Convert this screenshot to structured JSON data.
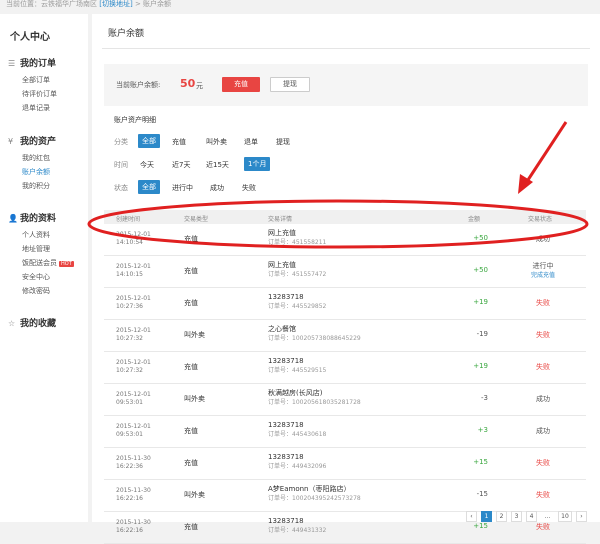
{
  "breadcrumb": {
    "prefix": "当前位置：",
    "location": "云铁福华广场南区",
    "switch_link": "[切换地址]",
    "current": "> 账户余额"
  },
  "sidebar": {
    "user_center": "个人中心",
    "sections": [
      {
        "icon": "☰",
        "title": "我的订单",
        "items": [
          "全部订单",
          "待评价订单",
          "退单记录"
        ]
      },
      {
        "icon": "¥",
        "title": "我的资产",
        "items": [
          "我的红包",
          "账户余额",
          "我的积分"
        ]
      },
      {
        "icon": "👤",
        "title": "我的资料",
        "items": [
          "个人资料",
          "地址管理",
          "饭配送会员",
          "安全中心",
          "修改密码"
        ],
        "hot_badge": "HOT"
      },
      {
        "icon": "☆",
        "title": "我的收藏",
        "items": []
      }
    ],
    "active_item": "账户余额"
  },
  "main": {
    "title": "账户余额",
    "balance_label": "当前账户余额:",
    "balance_amount": "50",
    "balance_unit": "元",
    "recharge_button": "充值",
    "withdraw_button": "提现",
    "detail_title": "账户资产明细",
    "filters": [
      {
        "key": "分类",
        "options": [
          "全部",
          "充值",
          "叫外卖",
          "退单",
          "提现"
        ],
        "selected": "全部"
      },
      {
        "key": "时间",
        "options": [
          "今天",
          "近7天",
          "近15天",
          "1个月"
        ],
        "selected": "1个月"
      },
      {
        "key": "状态",
        "options": [
          "全部",
          "进行中",
          "成功",
          "失败"
        ],
        "selected": "全部"
      }
    ]
  },
  "table": {
    "headers": [
      "创建时间",
      "交易类型",
      "交易详情",
      "金额",
      "交易状态"
    ],
    "rows": [
      {
        "date": "2015-12-01",
        "time": "14:10:54",
        "type": "充值",
        "detail": "网上充值",
        "order": "订单号：451558211",
        "amount": "+50",
        "sign": "pos",
        "status": "成功",
        "status_kind": "ok"
      },
      {
        "date": "2015-12-01",
        "time": "14:10:15",
        "type": "充值",
        "detail": "网上充值",
        "order": "订单号：451557472",
        "amount": "+50",
        "sign": "pos",
        "status": "进行中",
        "status_kind": "proc",
        "status_link": "完成充值"
      },
      {
        "date": "2015-12-01",
        "time": "10:27:36",
        "type": "充值",
        "detail": "13283718",
        "order": "订单号：445529852",
        "amount": "+19",
        "sign": "pos",
        "status": "失败",
        "status_kind": "fail"
      },
      {
        "date": "2015-12-01",
        "time": "10:27:32",
        "type": "叫外卖",
        "detail": "之心餐馆",
        "order": "订单号：100205738088645229",
        "amount": "-19",
        "sign": "neg",
        "status": "失败",
        "status_kind": "fail"
      },
      {
        "date": "2015-12-01",
        "time": "10:27:32",
        "type": "充值",
        "detail": "13283718",
        "order": "订单号：445529515",
        "amount": "+19",
        "sign": "pos",
        "status": "失败",
        "status_kind": "fail"
      },
      {
        "date": "2015-12-01",
        "time": "09:53:01",
        "type": "叫外卖",
        "detail": "秋满越房(长风店)",
        "order": "订单号：100205618035281728",
        "amount": "-3",
        "sign": "neg",
        "status": "成功",
        "status_kind": "ok"
      },
      {
        "date": "2015-12-01",
        "time": "09:53:01",
        "type": "充值",
        "detail": "13283718",
        "order": "订单号：445430618",
        "amount": "+3",
        "sign": "pos",
        "status": "成功",
        "status_kind": "ok"
      },
      {
        "date": "2015-11-30",
        "time": "16:22:36",
        "type": "充值",
        "detail": "13283718",
        "order": "订单号：449432096",
        "amount": "+15",
        "sign": "pos",
        "status": "失败",
        "status_kind": "fail"
      },
      {
        "date": "2015-11-30",
        "time": "16:22:16",
        "type": "叫外卖",
        "detail": "A梦Eamonn（枣阳路店）",
        "order": "订单号：100204395242573278",
        "amount": "-15",
        "sign": "neg",
        "status": "失败",
        "status_kind": "fail"
      },
      {
        "date": "2015-11-30",
        "time": "16:22:16",
        "type": "充值",
        "detail": "13283718",
        "order": "订单号：449431332",
        "amount": "+15",
        "sign": "pos",
        "status": "失败",
        "status_kind": "fail"
      }
    ]
  },
  "pager": {
    "prev": "‹",
    "pages": [
      "1",
      "2",
      "3",
      "4"
    ],
    "ellipsis": "...",
    "last": "10",
    "next": "›",
    "current": "1"
  },
  "colors": {
    "accent_blue": "#2c89c9",
    "accent_red": "#e84542",
    "positive_green": "#3aa73f"
  }
}
